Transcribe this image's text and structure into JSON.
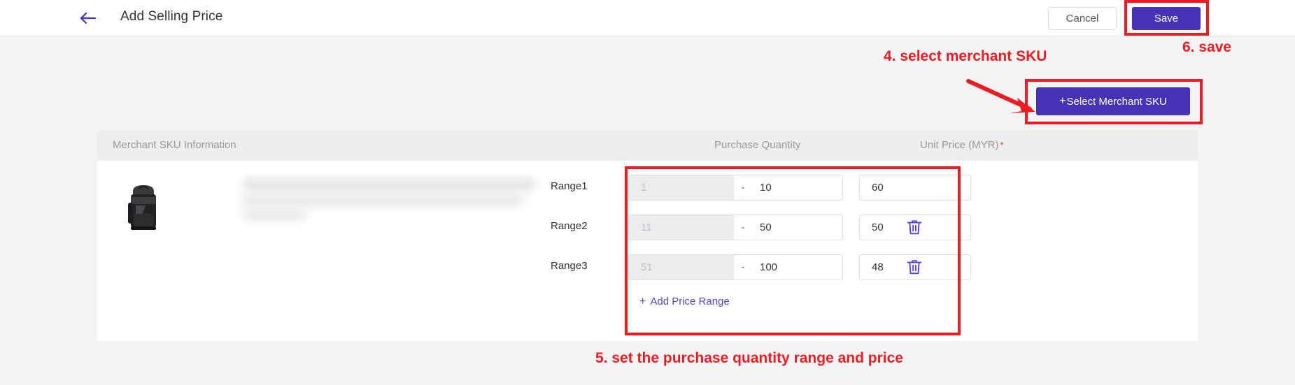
{
  "header": {
    "back_icon": "arrow-left-icon",
    "title": "Add Selling Price",
    "cancel_label": "Cancel",
    "save_label": "Save"
  },
  "toolbar": {
    "select_sku_plus": "+",
    "select_sku_label": "Select Merchant SKU"
  },
  "table": {
    "columns": {
      "sku_information": "Merchant SKU Information",
      "purchase_quantity": "Purchase Quantity",
      "unit_price": "Unit Price (MYR)",
      "required_marker": "*"
    },
    "rows": [
      {
        "product_icon": "backpack-product-image",
        "ranges": [
          {
            "label": "Range1",
            "min_placeholder": "1",
            "max_value": "10",
            "price_value": "60",
            "delete_icon": "trash-icon",
            "has_delete": false
          },
          {
            "label": "Range2",
            "min_placeholder": "11",
            "max_value": "50",
            "price_value": "50",
            "delete_icon": "trash-icon",
            "has_delete": true
          },
          {
            "label": "Range3",
            "min_placeholder": "51",
            "max_value": "100",
            "price_value": "48",
            "delete_icon": "trash-icon",
            "has_delete": true
          }
        ],
        "add_range_plus": "+",
        "add_range_label": "Add Price Range"
      }
    ]
  },
  "annotations": {
    "step4": "4. select merchant SKU",
    "step5": "5. set the purchase quantity range and price",
    "step6": "6. save",
    "color": "#ee1c22"
  },
  "colors": {
    "brand_purple": "#4632b4",
    "link_purple": "#5145cd",
    "page_bg": "#f4f4f5",
    "header_bg": "#eeeeee",
    "required_red": "#e8352c"
  }
}
